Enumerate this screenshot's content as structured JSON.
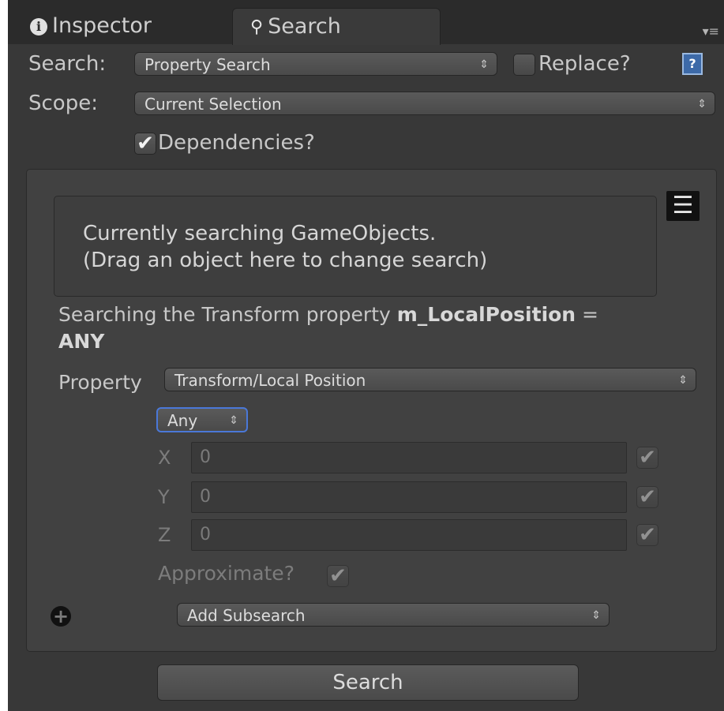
{
  "tabs": {
    "inspector_label": "Inspector",
    "search_label": "Search"
  },
  "search_row": {
    "label": "Search:",
    "mode_value": "Property Search",
    "replace_label": "Replace?",
    "replace_checked": false,
    "help_icon": "?"
  },
  "scope_row": {
    "label": "Scope:",
    "value": "Current Selection",
    "dependencies_label": "Dependencies?",
    "dependencies_checked": true
  },
  "target": {
    "line1": "Currently searching GameObjects.",
    "line2": "(Drag an object here to change search)"
  },
  "summary": {
    "prefix": "Searching the Transform property ",
    "property": "m_LocalPosition",
    "suffix": " =",
    "value": "ANY"
  },
  "property_row": {
    "label": "Property",
    "value": "Transform/Local Position"
  },
  "match_mode": {
    "value": "Any"
  },
  "vector_fields": [
    {
      "axis": "X",
      "value": "0",
      "checked": true
    },
    {
      "axis": "Y",
      "value": "0",
      "checked": true
    },
    {
      "axis": "Z",
      "value": "0",
      "checked": true
    }
  ],
  "approximate": {
    "label": "Approximate?",
    "checked": true
  },
  "subsearch": {
    "value": "Add Subsearch"
  },
  "search_button": {
    "label": "Search"
  },
  "glyphs": {
    "arrows": "⇕",
    "check": "✔",
    "info": "i",
    "magnifier": "🔍",
    "hamburger": "☰",
    "plus": "+",
    "menu": "▾≡"
  },
  "colors": {
    "panel_bg": "#383838",
    "tab_bar_bg": "#2b2b2b",
    "focus_blue": "#4a78d8",
    "help_blue": "#3d6aa8"
  }
}
